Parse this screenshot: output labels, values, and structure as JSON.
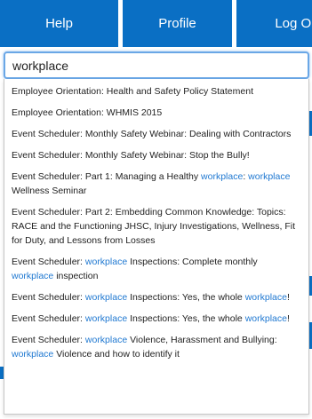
{
  "nav": {
    "help_label": "Help",
    "profile_label": "Profile",
    "logout_label": "Log Out"
  },
  "search": {
    "value": "workplace",
    "placeholder": ""
  },
  "colors": {
    "nav_blue": "#0a6fc4",
    "highlight_blue": "#1f78d1",
    "text": "#222222"
  },
  "suggestions": [
    {
      "segments": [
        {
          "text": "Employee Orientation: Health and Safety Policy Statement",
          "hl": false
        }
      ]
    },
    {
      "segments": [
        {
          "text": "Employee Orientation: WHMIS 2015",
          "hl": false
        }
      ]
    },
    {
      "segments": [
        {
          "text": "Event Scheduler: Monthly Safety Webinar: Dealing with Contractors",
          "hl": false
        }
      ]
    },
    {
      "segments": [
        {
          "text": "Event Scheduler: Monthly Safety Webinar: Stop the Bully!",
          "hl": false
        }
      ]
    },
    {
      "segments": [
        {
          "text": "Event Scheduler: Part 1: Managing a Healthy ",
          "hl": false
        },
        {
          "text": "workplace",
          "hl": true
        },
        {
          "text": ": ",
          "hl": false
        },
        {
          "text": "workplace",
          "hl": true
        },
        {
          "text": " Wellness Seminar",
          "hl": false
        }
      ]
    },
    {
      "segments": [
        {
          "text": "Event Scheduler: Part 2: Embedding Common Knowledge: Topics: RACE and the Functioning JHSC, Injury Investigations, Wellness, Fit for Duty, and Lessons from Losses",
          "hl": false
        }
      ]
    },
    {
      "segments": [
        {
          "text": "Event Scheduler: ",
          "hl": false
        },
        {
          "text": "workplace",
          "hl": true
        },
        {
          "text": " Inspections: Complete monthly ",
          "hl": false
        },
        {
          "text": "workplace",
          "hl": true
        },
        {
          "text": " inspection",
          "hl": false
        }
      ]
    },
    {
      "segments": [
        {
          "text": "Event Scheduler: ",
          "hl": false
        },
        {
          "text": "workplace",
          "hl": true
        },
        {
          "text": " Inspections: Yes, the whole ",
          "hl": false
        },
        {
          "text": "workplace",
          "hl": true
        },
        {
          "text": "!",
          "hl": false
        }
      ]
    },
    {
      "segments": [
        {
          "text": "Event Scheduler: ",
          "hl": false
        },
        {
          "text": "workplace",
          "hl": true
        },
        {
          "text": " Inspections: Yes, the whole ",
          "hl": false
        },
        {
          "text": "workplace",
          "hl": true
        },
        {
          "text": "!",
          "hl": false
        }
      ]
    },
    {
      "segments": [
        {
          "text": "Event Scheduler: ",
          "hl": false
        },
        {
          "text": "workplace",
          "hl": true
        },
        {
          "text": " Violence, Harassment and Bullying: ",
          "hl": false
        },
        {
          "text": "workplace",
          "hl": true
        },
        {
          "text": " Violence and how to identify it",
          "hl": false
        }
      ]
    }
  ]
}
